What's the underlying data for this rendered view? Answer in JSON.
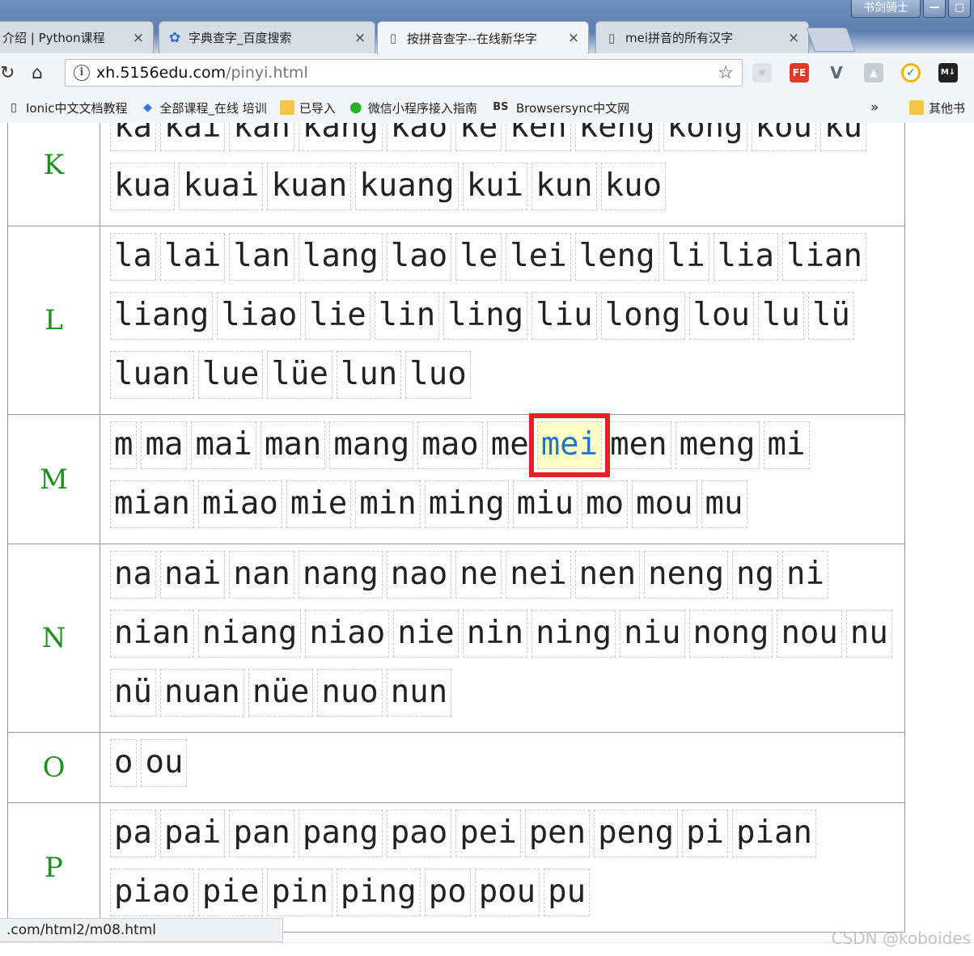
{
  "browser": {
    "window_title": "书剑骑士",
    "tabs": [
      {
        "title": "介绍 | Python课程",
        "icon": "page-icon",
        "active": false
      },
      {
        "title": "字典查字_百度搜索",
        "icon": "baidu-paw-icon",
        "active": false
      },
      {
        "title": "按拼音查字--在线新华字",
        "icon": "page-icon",
        "active": true
      },
      {
        "title": "mei拼音的所有汉字",
        "icon": "page-icon",
        "active": false
      }
    ],
    "close_glyph": "×",
    "address": {
      "host": "xh.5156edu.com",
      "path": "/pinyi.html"
    },
    "extensions": [
      "FE",
      "V",
      "M↓"
    ],
    "bookmarks": [
      {
        "label": "Ionic中文文档教程",
        "icon": "page-icon"
      },
      {
        "label": "全部课程_在线 培训",
        "icon": "gem-icon"
      },
      {
        "label": "已导入",
        "icon": "folder-icon"
      },
      {
        "label": "微信小程序接入指南",
        "icon": "wechat-icon"
      },
      {
        "label": "Browsersync中文网",
        "icon": "bs-icon",
        "prefix": "BS"
      }
    ],
    "more_bookmarks": "»",
    "other_bookmarks": "其他书",
    "status_url": ".com/html2/m08.html"
  },
  "pinyin": {
    "highlighted": "mei",
    "rows": [
      {
        "letter": "K",
        "syllables": [
          "ka",
          "kai",
          "kan",
          "kang",
          "kao",
          "ke",
          "ken",
          "keng",
          "kong",
          "kou",
          "ku",
          "kua",
          "kuai",
          "kuan",
          "kuang",
          "kui",
          "kun",
          "kuo"
        ]
      },
      {
        "letter": "L",
        "syllables": [
          "la",
          "lai",
          "lan",
          "lang",
          "lao",
          "le",
          "lei",
          "leng",
          "li",
          "lia",
          "lian",
          "liang",
          "liao",
          "lie",
          "lin",
          "ling",
          "liu",
          "long",
          "lou",
          "lu",
          "lü",
          "luan",
          "lue",
          "lüe",
          "lun",
          "luo"
        ]
      },
      {
        "letter": "M",
        "syllables": [
          "m",
          "ma",
          "mai",
          "man",
          "mang",
          "mao",
          "me",
          "mei",
          "men",
          "meng",
          "mi",
          "mian",
          "miao",
          "mie",
          "min",
          "ming",
          "miu",
          "mo",
          "mou",
          "mu"
        ]
      },
      {
        "letter": "N",
        "syllables": [
          "na",
          "nai",
          "nan",
          "nang",
          "nao",
          "ne",
          "nei",
          "nen",
          "neng",
          "ng",
          "ni",
          "nian",
          "niang",
          "niao",
          "nie",
          "nin",
          "ning",
          "niu",
          "nong",
          "nou",
          "nu",
          "nü",
          "nuan",
          "nüe",
          "nuo",
          "nun"
        ]
      },
      {
        "letter": "O",
        "syllables": [
          "o",
          "ou"
        ]
      },
      {
        "letter": "P",
        "syllables": [
          "pa",
          "pai",
          "pan",
          "pang",
          "pao",
          "pei",
          "pen",
          "peng",
          "pi",
          "pian",
          "piao",
          "pie",
          "pin",
          "ping",
          "po",
          "pou",
          "pu"
        ]
      }
    ]
  },
  "watermark": "CSDN @koboides",
  "colors": {
    "letter": "#1e8e1e",
    "highlight_box": "#e52222",
    "highlight_text": "#1b77cc",
    "highlight_bg": "#ffffc8"
  }
}
